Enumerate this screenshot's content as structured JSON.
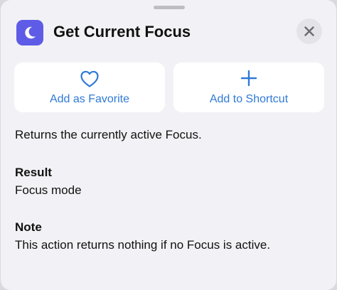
{
  "header": {
    "title": "Get Current Focus",
    "icon": "moon-icon",
    "icon_bg": "#5e5ce6"
  },
  "actions": {
    "favorite_label": "Add as Favorite",
    "shortcut_label": "Add to Shortcut",
    "accent": "#2e7ad6"
  },
  "description": "Returns the currently active Focus.",
  "result": {
    "heading": "Result",
    "value": "Focus mode"
  },
  "note": {
    "heading": "Note",
    "text": "This action returns nothing if no Focus is active."
  }
}
